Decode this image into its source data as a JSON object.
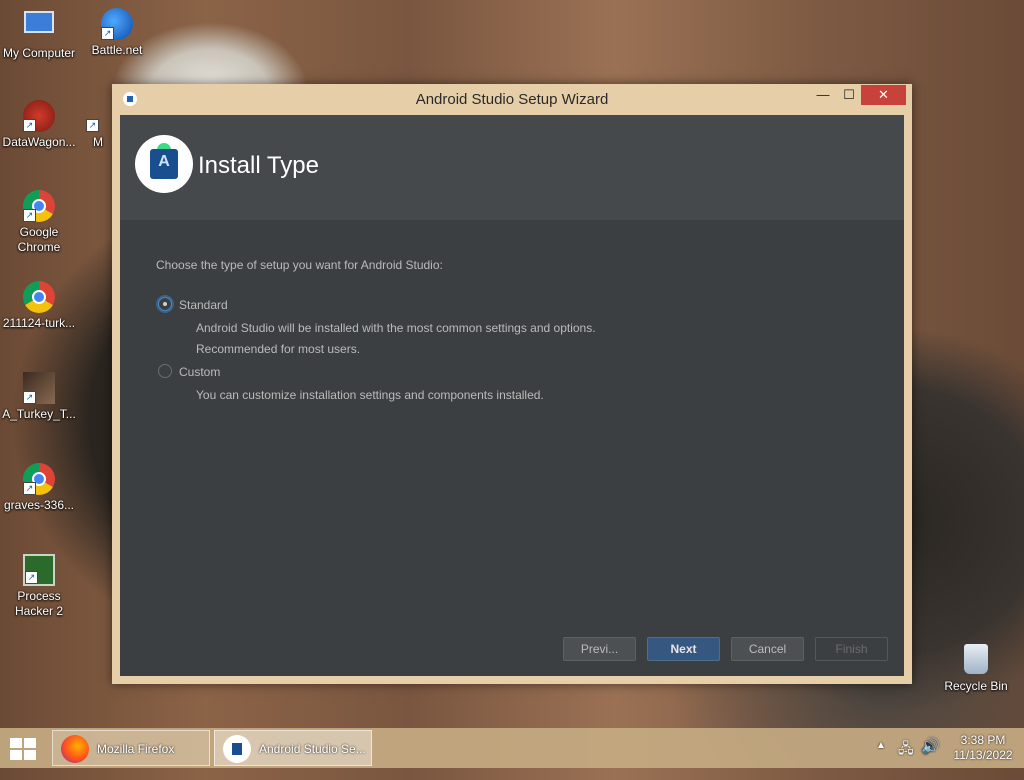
{
  "desktop": {
    "icons": [
      {
        "label": "My Computer"
      },
      {
        "label": "Battle.net"
      },
      {
        "label": "DataWagon..."
      },
      {
        "label": "M"
      },
      {
        "label": "Google Chrome"
      },
      {
        "label": "211124-turk..."
      },
      {
        "label": "A_Turkey_T..."
      },
      {
        "label": "graves-336..."
      },
      {
        "label": "Process Hacker 2"
      },
      {
        "label": "Recycle Bin"
      }
    ]
  },
  "window": {
    "title": "Android Studio Setup Wizard",
    "controls": {
      "minimize": "—",
      "maximize": "☐",
      "close": "✕"
    }
  },
  "wizard": {
    "header_title": "Install Type",
    "prompt": "Choose the type of setup you want for Android Studio:",
    "options": [
      {
        "label": "Standard",
        "selected": true,
        "desc1": "Android Studio will be installed with the most common settings and options.",
        "desc2": "Recommended for most users."
      },
      {
        "label": "Custom",
        "selected": false,
        "desc1": "You can customize installation settings and components installed."
      }
    ],
    "buttons": {
      "prev": "Previ...",
      "next": "Next",
      "cancel": "Cancel",
      "finish": "Finish"
    }
  },
  "taskbar": {
    "items": [
      {
        "label": "Mozilla Firefox"
      },
      {
        "label": "Android Studio Se..."
      }
    ],
    "clock_time": "3:38 PM",
    "clock_date": "11/13/2022"
  }
}
